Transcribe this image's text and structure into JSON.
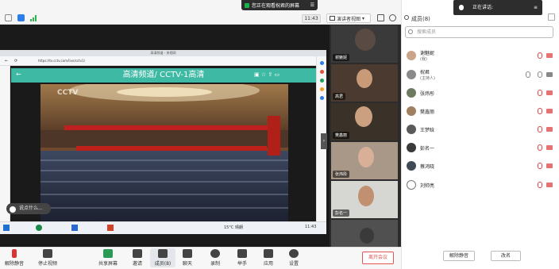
{
  "top": {
    "share_banner": "您正在观看祝君的屏幕",
    "time": "11:43",
    "view_mode": "演讲者视图",
    "panel_title": "成员(8)",
    "toast": "正在讲话:"
  },
  "browser": {
    "window_title": "高清频道 - 央视网",
    "url": "https://tv.cctv.com/live/cctv1/",
    "channel": "高清频道/ CCTV-1高清",
    "corner_logo": "CCTV",
    "tray_temp": "15°C 晴朗",
    "clock": "11:43",
    "chat_placeholder": "说点什么..."
  },
  "thumbs": [
    {
      "name": "谢魅妮"
    },
    {
      "name": "高君"
    },
    {
      "name": "樊鑫丽"
    },
    {
      "name": "张炜彤"
    },
    {
      "name": "彭名一"
    },
    {
      "name": ""
    }
  ],
  "members": {
    "search_placeholder": "搜索成员",
    "list": [
      {
        "name": "谢魅妮",
        "sub": "(我)",
        "color": "#c9a48a"
      },
      {
        "name": "祝君",
        "sub": "(主持人)",
        "color": "#8a8a8a"
      },
      {
        "name": "张炜彤",
        "sub": "",
        "color": "#6d7b63"
      },
      {
        "name": "樊鑫丽",
        "sub": "",
        "color": "#a08060"
      },
      {
        "name": "王梦晗",
        "sub": "",
        "color": "#5a5a5a"
      },
      {
        "name": "彭名一",
        "sub": "",
        "color": "#3a3a3a"
      },
      {
        "name": "蔡鸿晓",
        "sub": "",
        "color": "#404a55"
      },
      {
        "name": "刘帅亮",
        "sub": "",
        "color": "#7d7d7d"
      }
    ],
    "mute_all": "解除静音",
    "rename": "改名"
  },
  "toolbar": {
    "mute": "解除静音",
    "video": "停止视频",
    "share": "共享屏幕",
    "invite": "邀请",
    "members": "成员(8)",
    "chat": "聊天",
    "record": "录制",
    "raise": "举手",
    "apps": "应用",
    "settings": "设置",
    "leave": "离开会议"
  },
  "colors": {
    "accent": "#3eb9a4",
    "leave": "#e25555"
  }
}
